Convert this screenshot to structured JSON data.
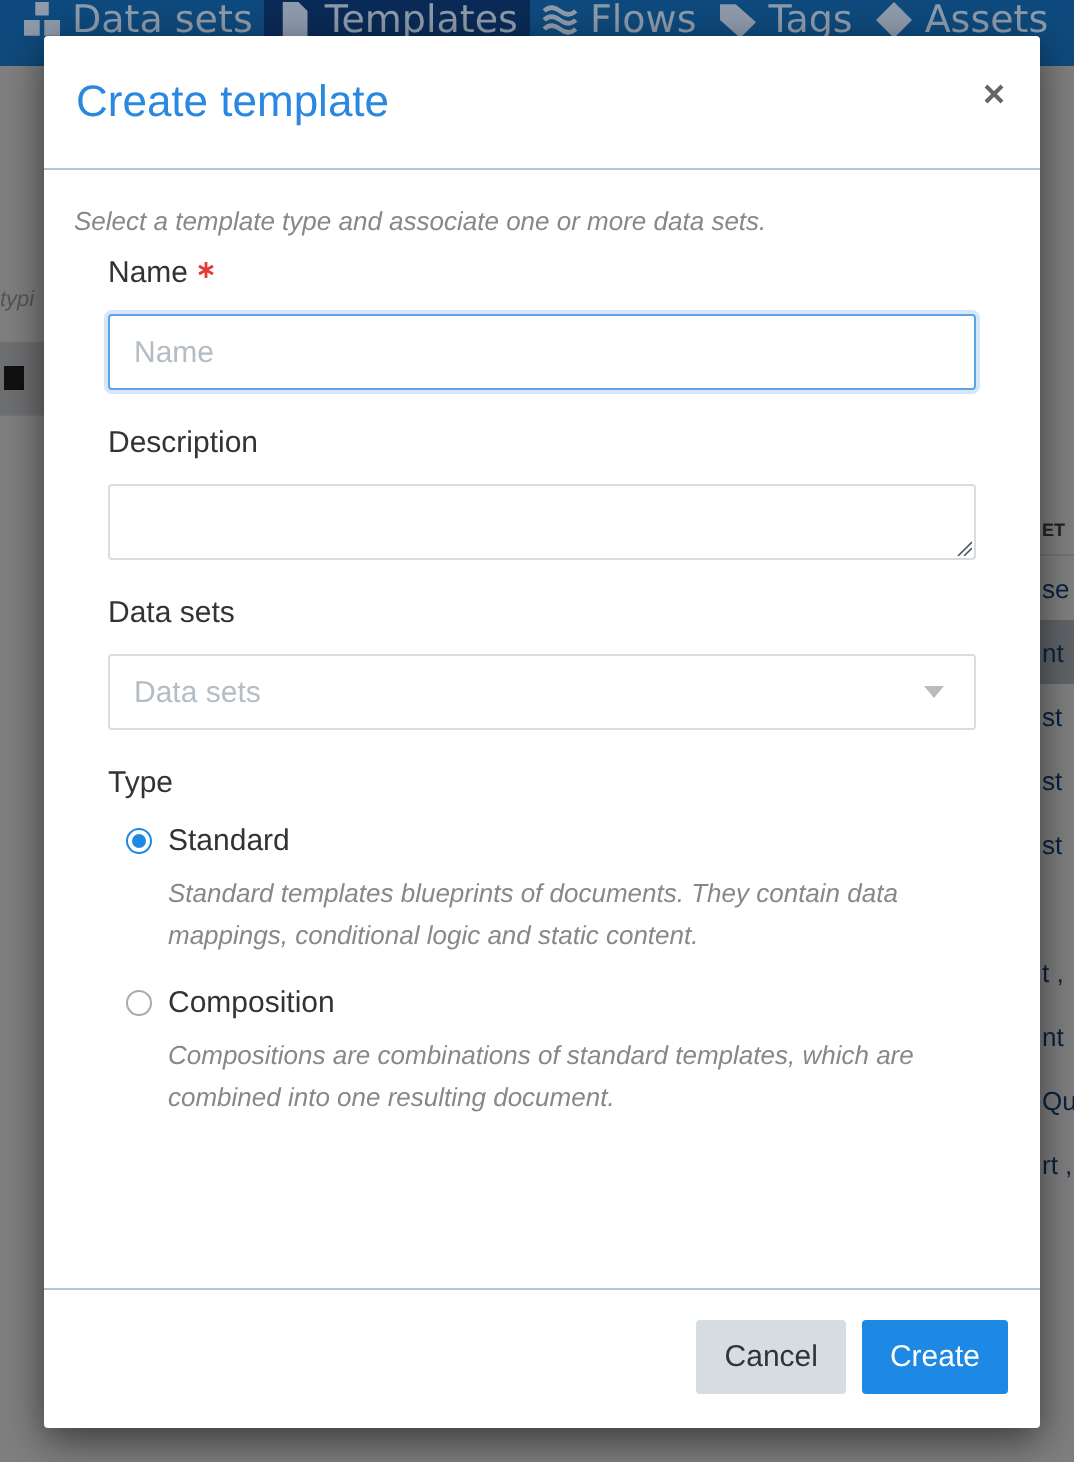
{
  "nav": {
    "tabs": [
      {
        "label": "Data sets",
        "selected": false
      },
      {
        "label": "Templates",
        "selected": true
      },
      {
        "label": "Flows",
        "selected": false
      },
      {
        "label": "Tags",
        "selected": false
      },
      {
        "label": "Assets",
        "selected": false
      }
    ]
  },
  "background": {
    "left_hint": "typi",
    "right_header": "ET",
    "right_rows": [
      {
        "text": "se",
        "selected": false
      },
      {
        "text": "nt",
        "selected": true
      },
      {
        "text": "st",
        "selected": false
      },
      {
        "text": "st",
        "selected": false
      },
      {
        "text": "st",
        "selected": false
      },
      {
        "text": "",
        "selected": false
      },
      {
        "text": "t ,",
        "selected": false
      },
      {
        "text": "nt",
        "selected": false
      },
      {
        "text": "Qu",
        "selected": false
      },
      {
        "text": "rt ,",
        "selected": false
      }
    ]
  },
  "dialog": {
    "title": "Create template",
    "intro": "Select a template type and associate one or more data sets.",
    "name": {
      "label": "Name",
      "required": true,
      "placeholder": "Name",
      "focused": true
    },
    "description": {
      "label": "Description"
    },
    "data_sets": {
      "label": "Data sets",
      "placeholder": "Data sets"
    },
    "type": {
      "label": "Type",
      "options": [
        {
          "label": "Standard",
          "help": "Standard templates blueprints of documents. They contain data mappings, conditional logic and static content.",
          "selected": true
        },
        {
          "label": "Composition",
          "help": "Compositions are combinations of standard templates, which are combined into one resulting document.",
          "selected": false
        }
      ]
    },
    "buttons": [
      {
        "label": "Cancel",
        "kind": "secondary"
      },
      {
        "label": "Create",
        "kind": "primary"
      }
    ]
  }
}
